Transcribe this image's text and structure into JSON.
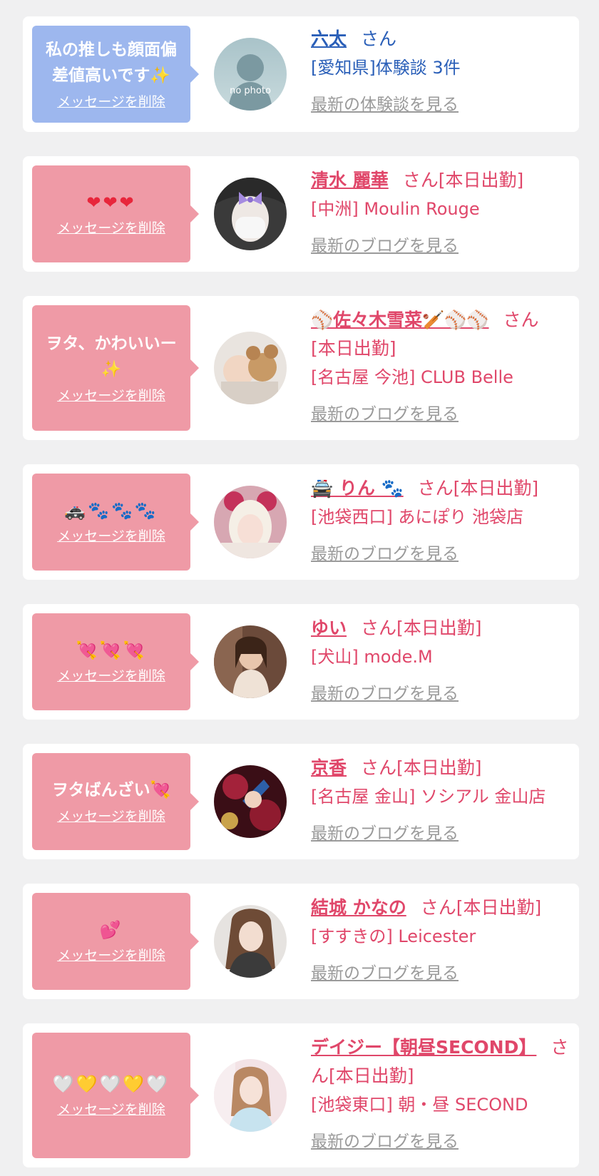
{
  "items": [
    {
      "message": "私の推しも顔面偏差値高いです✨",
      "delete_label": "メッセージを削除",
      "name": "六太",
      "suffix": "さん",
      "location": "[愛知県]体験談 3件",
      "link": "最新の体験談を見る",
      "avatar_text": "no photo"
    },
    {
      "message": "❤❤❤",
      "delete_label": "メッセージを削除",
      "name": "清水 麗華",
      "suffix": "さん[本日出勤]",
      "location": "[中洲] Moulin Rouge",
      "link": "最新のブログを見る"
    },
    {
      "message": "ヲタ、かわいいー✨",
      "delete_label": "メッセージを削除",
      "name": "⚾佐々木雪菜🏏⚾⚾",
      "suffix": "さん",
      "status": "[本日出勤]",
      "location": "[名古屋 今池] CLUB Belle",
      "link": "最新のブログを見る"
    },
    {
      "message": "🚓🐾🐾🐾",
      "delete_label": "メッセージを削除",
      "name": "🚔 りん 🐾",
      "suffix": "さん[本日出勤]",
      "location": "[池袋西口] あにぽり 池袋店",
      "link": "最新のブログを見る"
    },
    {
      "message": "💘💘💘",
      "delete_label": "メッセージを削除",
      "name": "ゆい",
      "suffix": "さん[本日出勤]",
      "location": "[犬山] mode.M",
      "link": "最新のブログを見る"
    },
    {
      "message": "ヲタばんざい💘",
      "delete_label": "メッセージを削除",
      "name": "京香",
      "suffix": "さん[本日出勤]",
      "location": "[名古屋 金山] ソシアル 金山店",
      "link": "最新のブログを見る"
    },
    {
      "message": "💕",
      "delete_label": "メッセージを削除",
      "name": "結城 かなの",
      "suffix": "さん[本日出勤]",
      "location": "[すすきの] Leicester",
      "link": "最新のブログを見る"
    },
    {
      "message": "🤍💛🤍💛🤍",
      "delete_label": "メッセージを削除",
      "name": "デイジー【朝昼SECOND】",
      "suffix": "さん[本日出勤]",
      "location": "[池袋東口] 朝・昼 SECOND",
      "link": "最新のブログを見る"
    }
  ],
  "colors": {
    "background": "#f0f0f1",
    "card": "#ffffff",
    "message_pink": "#ef9aa6",
    "message_blue": "#9db7ee",
    "name_pink": "#e0476a",
    "name_blue": "#2a5fb8",
    "link_gray": "#9a9a9a"
  }
}
